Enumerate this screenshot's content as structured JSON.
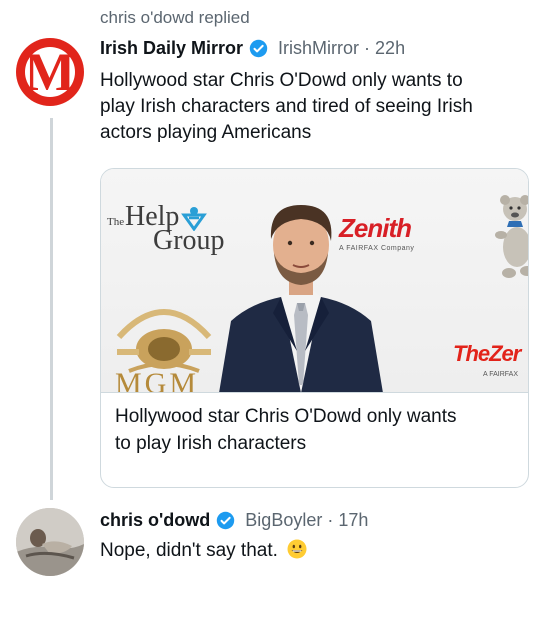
{
  "context": {
    "replied_label": "chris o'dowd replied"
  },
  "tweet": {
    "author_name": "Irish Daily Mirror",
    "handle": "IrishMirror",
    "separator": "·",
    "time": "22h",
    "avatar_letter": "M",
    "text_line1": "Hollywood star Chris O'Dowd only wants to",
    "text_line2": "play Irish characters and tired of seeing Irish",
    "text_line3": "actors playing Americans",
    "card": {
      "title_line1": "Hollywood star Chris O'Dowd only wants",
      "title_line2": "to play Irish characters",
      "backdrop": {
        "help_the": "The",
        "help_word": "Help",
        "help_group": "Group",
        "zenith": "Zenith",
        "zenith_sub": "A FAIRFAX Company",
        "mgm": "MGM",
        "theze": "TheZer",
        "theze_sub": "A FAIRFAX"
      }
    }
  },
  "reply": {
    "author_name": "chris o'dowd",
    "handle": "BigBoyler",
    "separator": "·",
    "time": "17h",
    "text": "Nope, didn't say that.",
    "emoji": "grinning-face-icon"
  },
  "colors": {
    "verified_blue": "#1d9bf0",
    "mirror_red": "#e1251b",
    "secondary_text": "#5b6670",
    "thread_line": "#cfd5d9"
  }
}
